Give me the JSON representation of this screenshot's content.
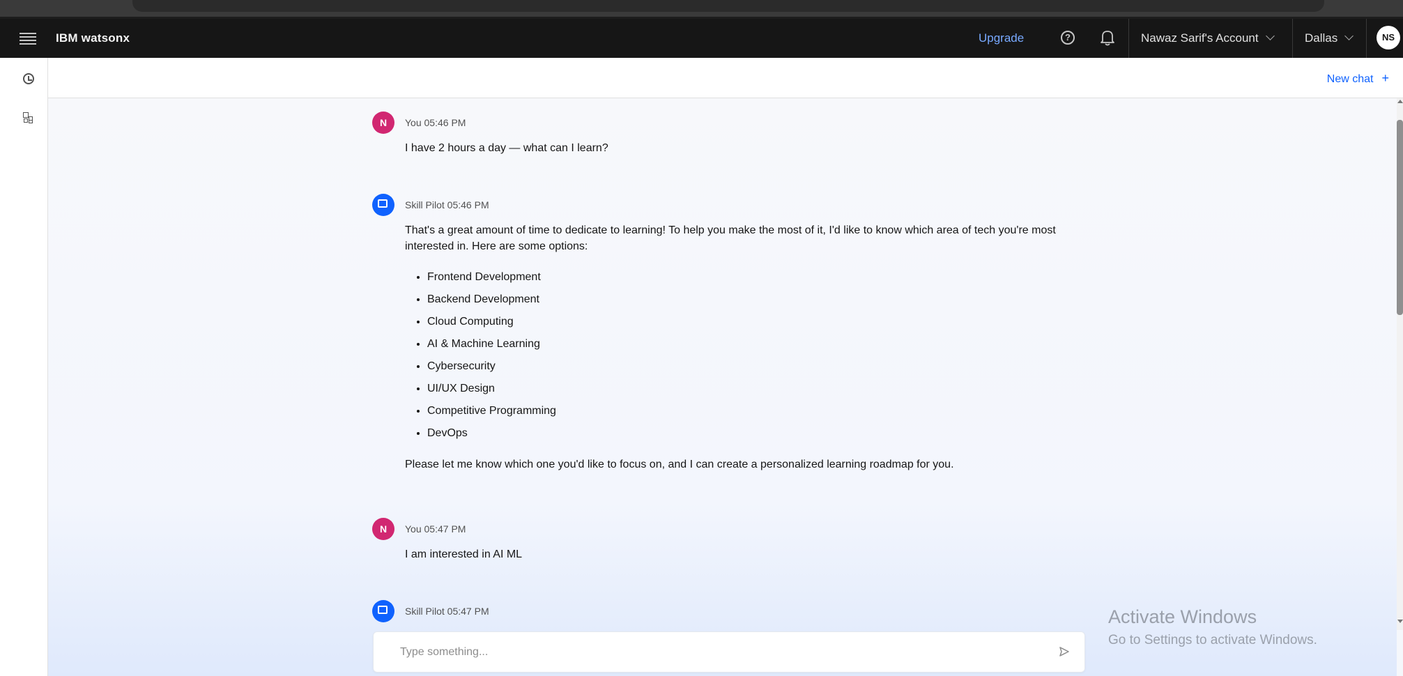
{
  "header": {
    "brand": "IBM watsonx",
    "upgrade_label": "Upgrade",
    "account_label": "Nawaz Sarif's Account",
    "region_label": "Dallas",
    "user_initials": "NS",
    "icons": [
      "menu-icon",
      "help-icon",
      "notification-bell-icon",
      "chevron-down-icon"
    ]
  },
  "sidebar": {
    "icons": [
      "history-clock-icon",
      "apps-grid-icon"
    ]
  },
  "subheader": {
    "new_chat_label": "New chat",
    "new_chat_icon": "+"
  },
  "messages": [
    {
      "sender": "You",
      "time": "05:46 PM",
      "meta": "You 05:46 PM",
      "avatar": "N",
      "text": "I have 2 hours a day — what can I learn?"
    },
    {
      "sender": "Skill Pilot",
      "time": "05:46 PM",
      "meta": "Skill Pilot 05:46 PM",
      "avatar_icon": "bot-chat-icon",
      "intro": "That's a great amount of time to dedicate to learning! To help you make the most of it, I'd like to know which area of tech you're most interested in. Here are some options:",
      "options": [
        "Frontend Development",
        "Backend Development",
        "Cloud Computing",
        "AI & Machine Learning",
        "Cybersecurity",
        "UI/UX Design",
        "Competitive Programming",
        "DevOps"
      ],
      "outro": "Please let me know which one you'd like to focus on, and I can create a personalized learning roadmap for you."
    },
    {
      "sender": "You",
      "time": "05:47 PM",
      "meta": "You 05:47 PM",
      "avatar": "N",
      "text": "I am interested in AI ML"
    },
    {
      "sender": "Skill Pilot",
      "time": "05:47 PM",
      "meta": "Skill Pilot 05:47 PM",
      "avatar_icon": "bot-chat-icon"
    }
  ],
  "composer": {
    "placeholder": "Type something...",
    "send_icon": "send-icon"
  },
  "watermark": {
    "title": "Activate Windows",
    "subtitle": "Go to Settings to activate Windows."
  },
  "colors": {
    "header_bg": "#161616",
    "link_blue": "#0f62fe",
    "upgrade_blue": "#78a9ff",
    "user_avatar": "#d12771",
    "bot_avatar": "#0f62fe"
  }
}
